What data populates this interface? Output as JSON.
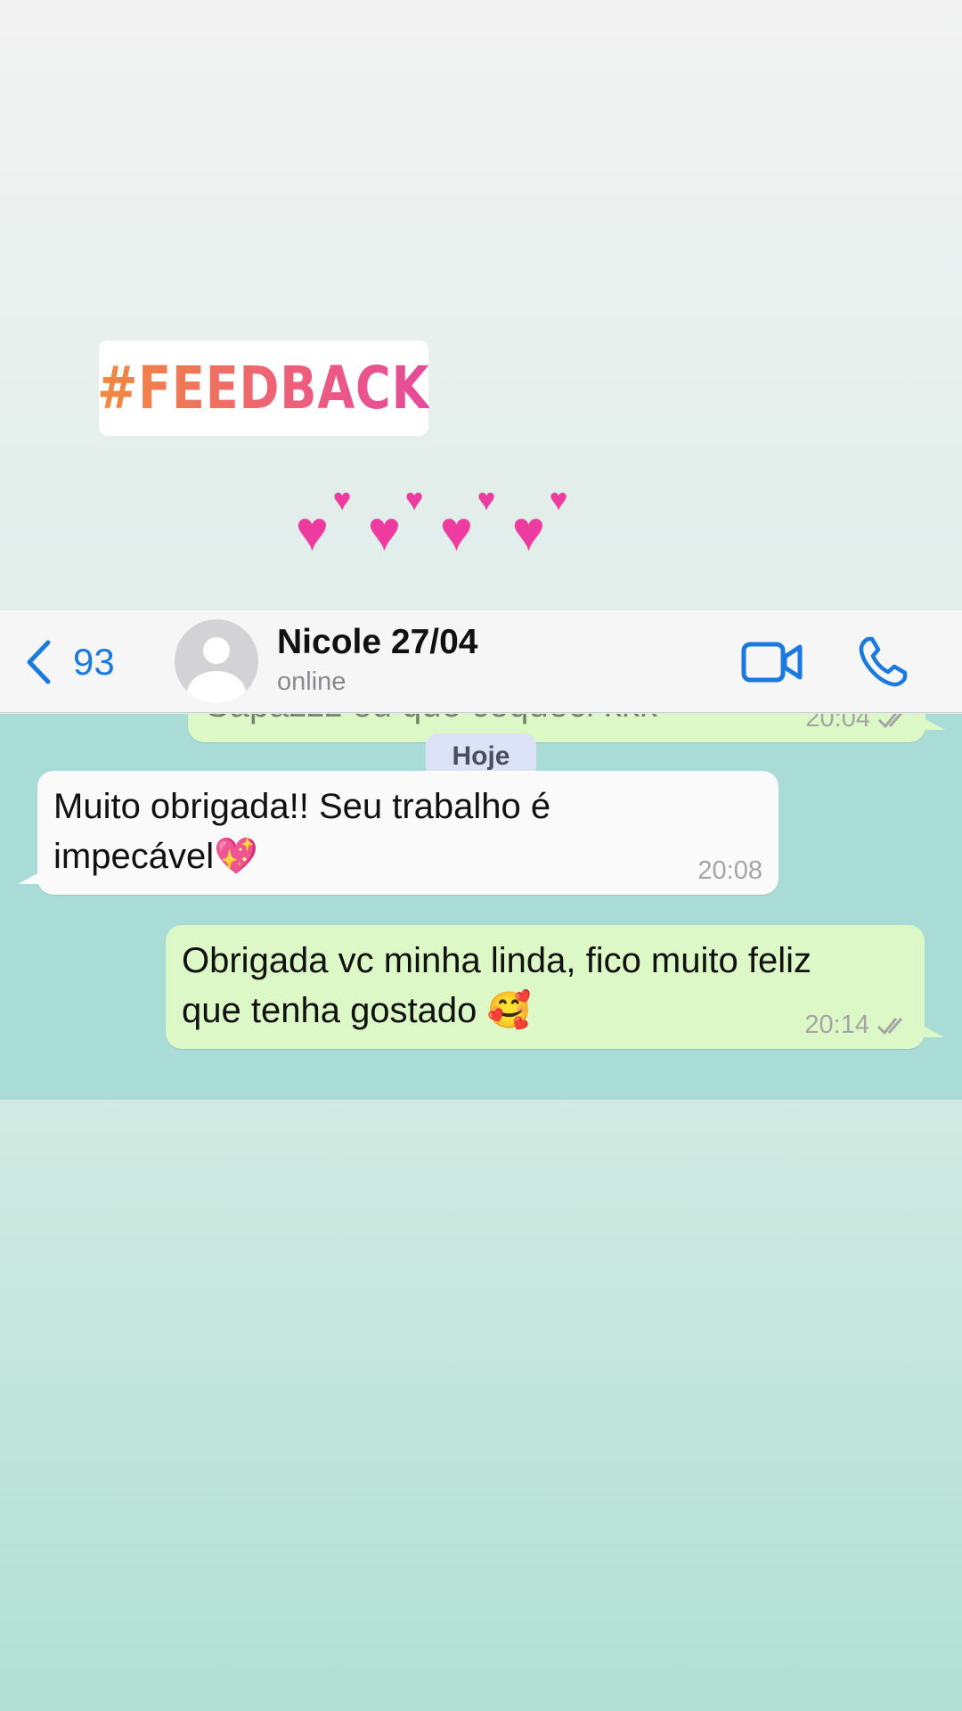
{
  "story": {
    "hashtag": "#FEEDBACK",
    "hearts_emoji": [
      "💕",
      "💕",
      "💕",
      "💕"
    ]
  },
  "header": {
    "back_count": "93",
    "contact_name": "Nicole 27/04",
    "status": "online"
  },
  "chat": {
    "previous_message": {
      "text": "Sapazzz eu que cequeci kkk",
      "time": "20:04"
    },
    "date_separator": "Hoje",
    "messages": [
      {
        "direction": "incoming",
        "text": "Muito obrigada!! Seu trabalho é\nimpecável💖",
        "time": "20:08"
      },
      {
        "direction": "outgoing",
        "text": "Obrigada vc minha linda, fico muito feliz\nque tenha gostado 🥰",
        "time": "20:14",
        "read_receipt": "double-check"
      }
    ]
  },
  "colors": {
    "accent": "#1a7ae0",
    "outgoing_bubble": "#dcf8c6",
    "incoming_bubble": "#fafafa",
    "chat_background": "#a9dcd6",
    "heart": "#ee3b9f"
  }
}
